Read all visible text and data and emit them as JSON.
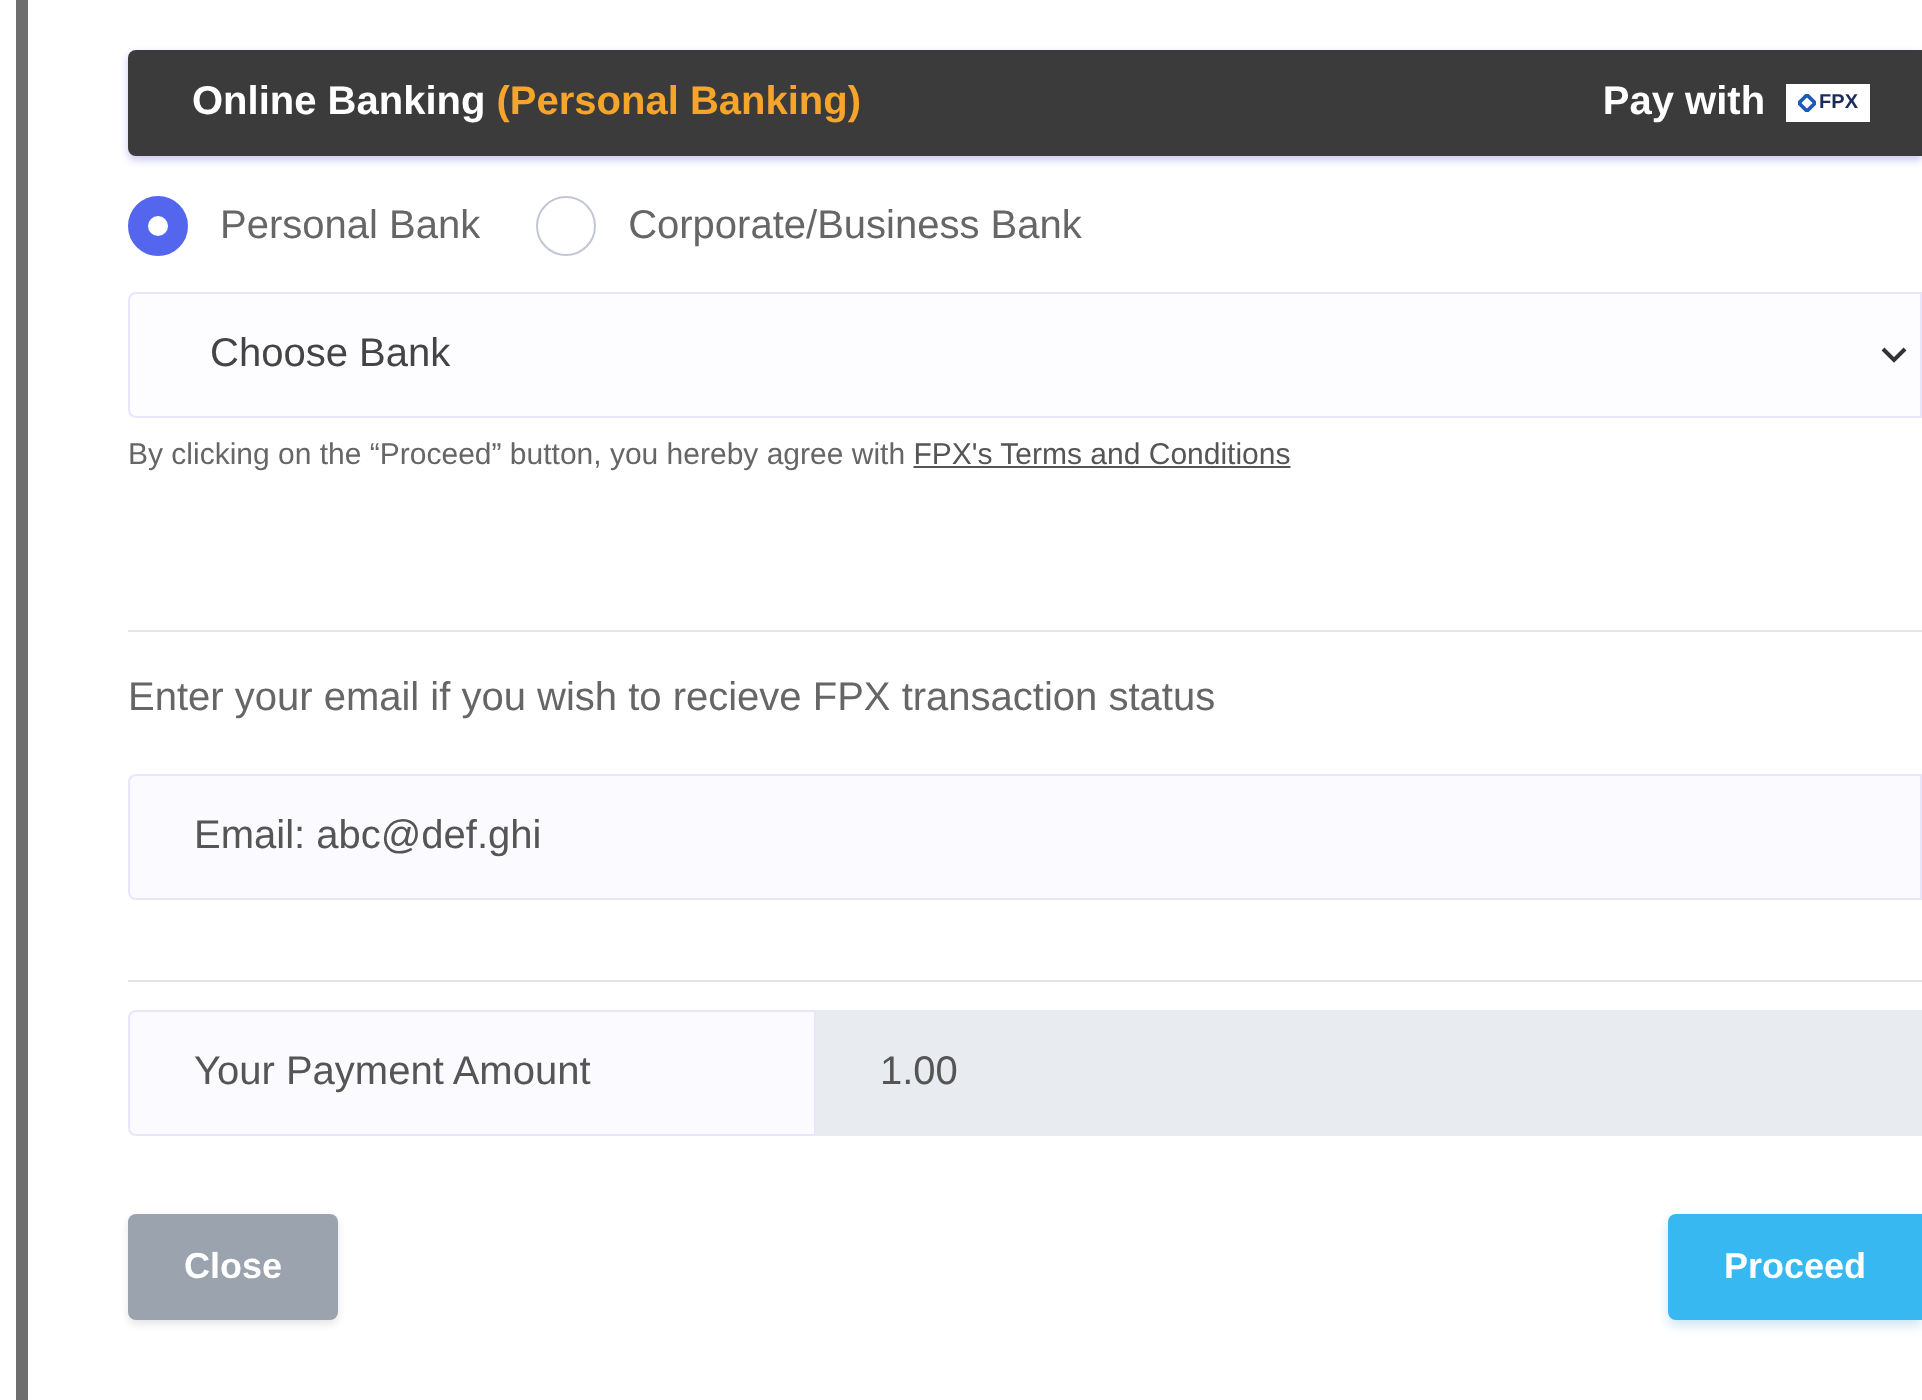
{
  "header": {
    "title": "Online Banking",
    "subtitle": "(Personal Banking)",
    "pay_with": "Pay with",
    "logo_text": "FPX"
  },
  "bank_types": [
    {
      "label": "Personal Bank",
      "selected": true
    },
    {
      "label": "Corporate/Business Bank",
      "selected": false
    }
  ],
  "bank_select": {
    "value": "Choose Bank"
  },
  "terms": {
    "text": "By clicking on the “Proceed” button, you hereby agree with",
    "link": "FPX's Terms and Conditions"
  },
  "email_prompt": "Enter your email if you wish to recieve FPX transaction status",
  "email_field": {
    "placeholder": "Email: abc@def.ghi"
  },
  "amount": {
    "label": "Your Payment Amount",
    "value": "1.00"
  },
  "buttons": [
    {
      "label": "Close",
      "disabled": true
    },
    {
      "label": "Proceed",
      "disabled": false
    }
  ]
}
